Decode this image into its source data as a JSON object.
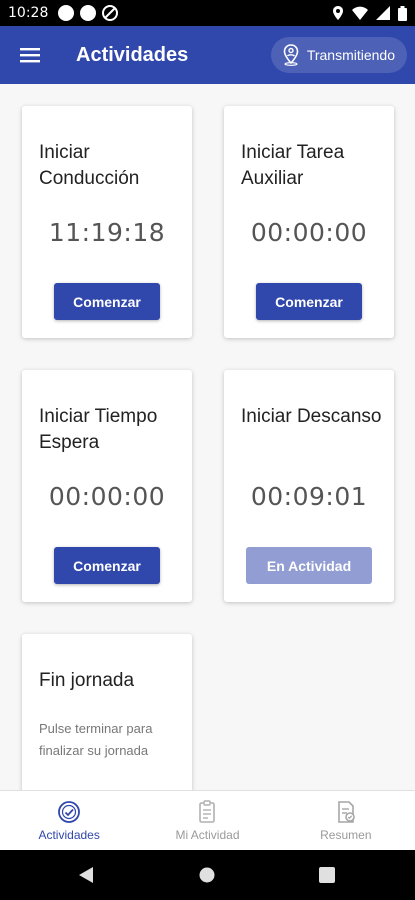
{
  "status_bar": {
    "time": "10:28"
  },
  "app_bar": {
    "title": "Actividades",
    "transmit_label": "Transmitiendo"
  },
  "cards": [
    {
      "title": "Iniciar Conducción",
      "timer": "11:19:18",
      "button": "Comenzar"
    },
    {
      "title": "Iniciar Tarea Auxiliar",
      "timer": "00:00:00",
      "button": "Comenzar"
    },
    {
      "title": "Iniciar Tiempo Espera",
      "timer": "00:00:00",
      "button": "Comenzar"
    },
    {
      "title": "Iniciar Descanso",
      "timer": "00:09:01",
      "button": "En Actividad"
    }
  ],
  "end_card": {
    "title": "Fin jornada",
    "description": "Pulse terminar para finalizar su jornada"
  },
  "bottom_nav": {
    "items": [
      {
        "label": "Actividades",
        "icon": "clock-check-icon",
        "active": true
      },
      {
        "label": "Mi Actividad",
        "icon": "clipboard-icon",
        "active": false
      },
      {
        "label": "Resumen",
        "icon": "document-icon",
        "active": false
      }
    ]
  },
  "colors": {
    "primary": "#3047ac",
    "button_active": "#929dd3"
  }
}
